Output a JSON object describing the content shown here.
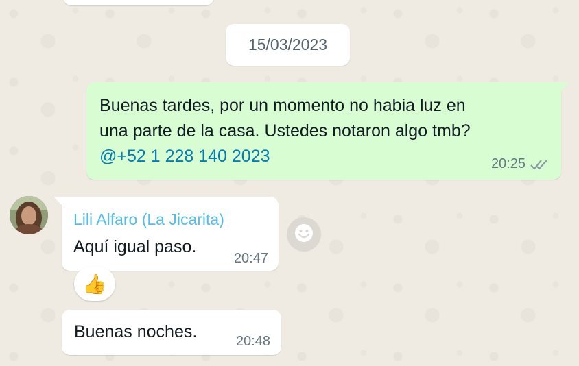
{
  "chat": {
    "date_divider": "15/03/2023",
    "outgoing_message": {
      "line1": "Buenas tardes, por un momento no habia luz en",
      "line2": "una parte de la casa. Ustedes notaron algo tmb?",
      "mention": "@+52 1 228 140 2023",
      "time": "20:25",
      "status_icon": "double-check-icon"
    },
    "incoming_messages": [
      {
        "sender": "Lili Alfaro (La Jicarita)",
        "text": "Aquí igual paso.",
        "time": "20:47",
        "reaction": "👍"
      },
      {
        "text": "Buenas noches.",
        "time": "20:48"
      }
    ],
    "emoji_button_icon": "smiley-icon"
  },
  "colors": {
    "background": "#efeae2",
    "outgoing_bubble": "#d9fdd3",
    "incoming_bubble": "#ffffff",
    "mention": "#027eb5",
    "sender_name": "#53bdeb",
    "meta_text": "#667781"
  }
}
